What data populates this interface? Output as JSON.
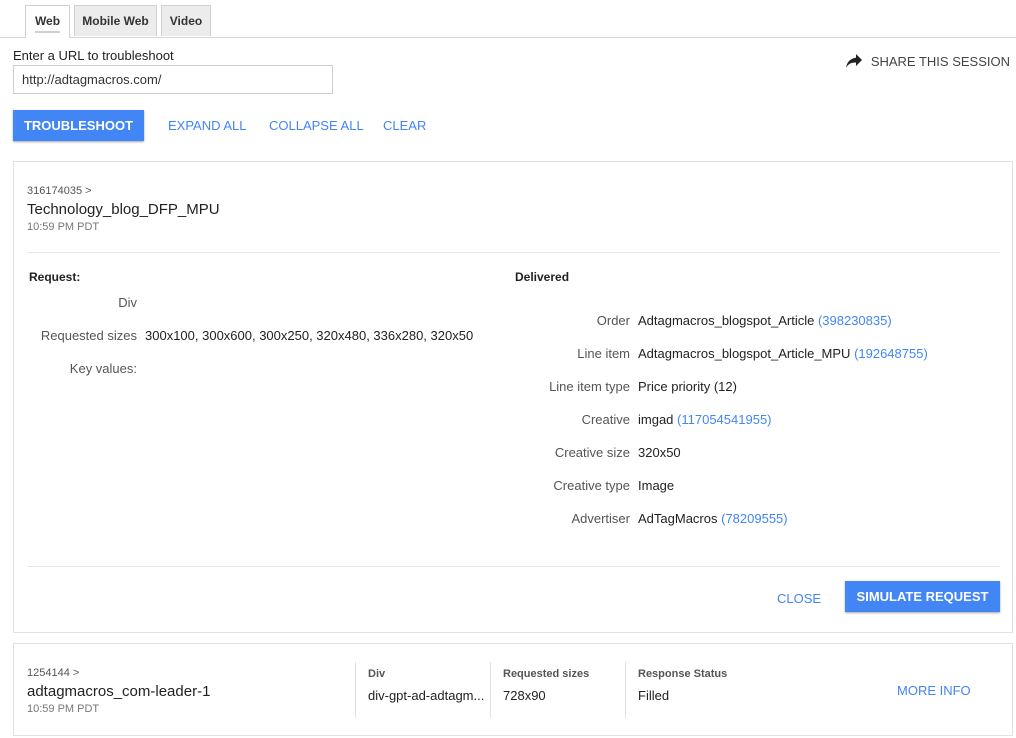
{
  "tabs": [
    "Web",
    "Mobile Web",
    "Video"
  ],
  "url_section": {
    "label": "Enter a URL to troubleshoot",
    "value": "http://adtagmacros.com/"
  },
  "share_label": "SHARE THIS SESSION",
  "toolbar": {
    "troubleshoot": "TROUBLESHOOT",
    "expand_all": "EXPAND ALL",
    "collapse_all": "COLLAPSE ALL",
    "clear": "CLEAR"
  },
  "slot1": {
    "id": "316174035 >",
    "name": "Technology_blog_DFP_MPU",
    "time": "10:59 PM PDT",
    "request": {
      "heading": "Request:",
      "rows": [
        {
          "label": "Div",
          "value": ""
        },
        {
          "label": "Requested sizes",
          "value": "300x100, 300x600, 300x250, 320x480, 336x280, 320x50"
        },
        {
          "label": "Key values:",
          "value": ""
        }
      ]
    },
    "delivered": {
      "heading": "Delivered",
      "rows": [
        {
          "label": "Order",
          "value": "Adtagmacros_blogspot_Article",
          "link": "(398230835)"
        },
        {
          "label": "Line item",
          "value": "Adtagmacros_blogspot_Article_MPU",
          "link": "(192648755)"
        },
        {
          "label": "Line item type",
          "value": "Price priority (12)",
          "link": ""
        },
        {
          "label": "Creative",
          "value": "imgad",
          "link": "(117054541955)"
        },
        {
          "label": "Creative size",
          "value": "320x50",
          "link": ""
        },
        {
          "label": "Creative type",
          "value": "Image",
          "link": ""
        },
        {
          "label": "Advertiser",
          "value": "AdTagMacros",
          "link": "(78209555)"
        }
      ]
    },
    "close_label": "CLOSE",
    "simulate_label": "SIMULATE REQUEST"
  },
  "slot2": {
    "id": "1254144 >",
    "name": "adtagmacros_com-leader-1",
    "time": "10:59 PM PDT",
    "div_header": "Div",
    "div_value": "div-gpt-ad-adtagm...",
    "sizes_header": "Requested sizes",
    "sizes_value": "728x90",
    "status_header": "Response Status",
    "status_value": "Filled",
    "more_info": "MORE INFO"
  },
  "colors": {
    "accent": "#4285f4"
  },
  "icons": {
    "share": "share-arrow-icon"
  }
}
